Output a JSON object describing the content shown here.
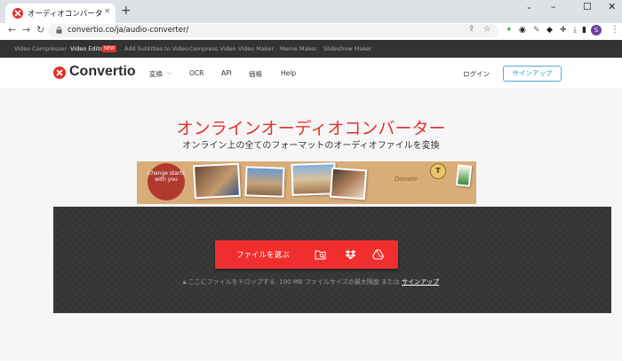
{
  "browser": {
    "tab_title": "オーディオコンバータ (オンライン フリー",
    "tab_close": "×",
    "new_tab": "+",
    "window": {
      "minimize": "–",
      "maximize": "☐",
      "close": "✕"
    },
    "url": "convertio.co/ja/audio-converter/",
    "profile_initial": "S"
  },
  "topbar": {
    "items": [
      "Video Compressor",
      "Video Editor",
      "Add Subtitles to Video",
      "Compress Video",
      "Video Maker",
      "Meme Maker",
      "Slideshow Maker"
    ],
    "new_badge": "NEW"
  },
  "header": {
    "logo": "Convertio",
    "nav": [
      "変換",
      "OCR",
      "API",
      "価格",
      "Help"
    ],
    "login": "ログイン",
    "signup": "サインアップ"
  },
  "main": {
    "title": "オンラインオーディオコンバーター",
    "subtitle": "オンライン上の全てのフォーマットのオーディオファイルを変換",
    "banner": {
      "circle_text": "Change starts with you",
      "donate": "Donate",
      "coin": "T"
    },
    "choose_button": "ファイルを選ぶ",
    "drop_hint": "ここにファイルをドロップする. 100 MB ファイルサイズの最大限度 または",
    "drop_hint_link": "サインアップ"
  },
  "colors": {
    "brand_red": "#e0322c",
    "button_red": "#f02e2e",
    "signup_blue": "#2a9fd0",
    "dark_bar": "#333333"
  },
  "icons": {
    "folder": "folder-search-icon",
    "dropbox": "dropbox-icon",
    "gdrive": "google-drive-icon"
  }
}
